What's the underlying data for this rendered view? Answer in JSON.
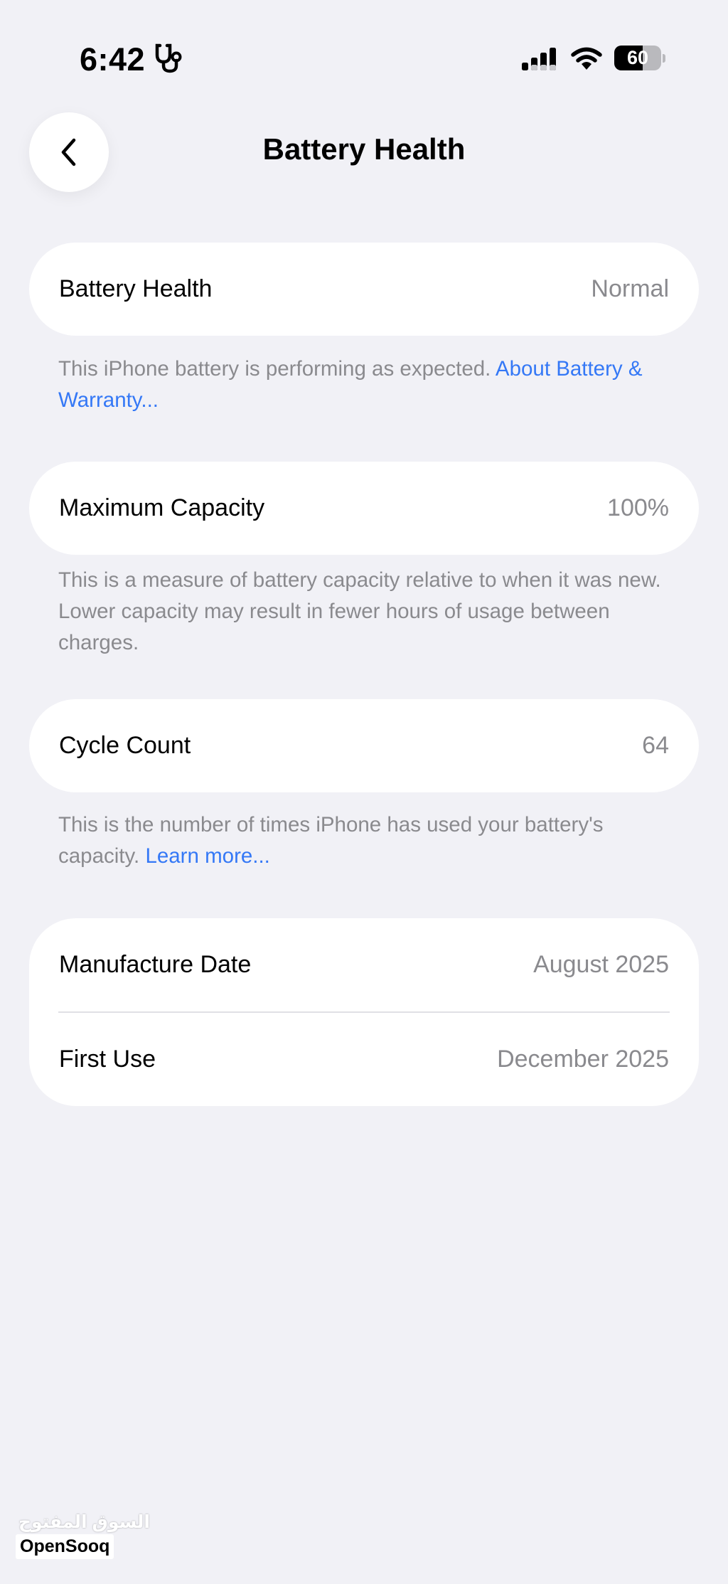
{
  "status_bar": {
    "time": "6:42",
    "battery_level": "60",
    "battery_fraction": 0.6,
    "icons": [
      "stethoscope-icon",
      "cellular-signal-icon",
      "wifi-icon",
      "battery-icon"
    ]
  },
  "nav": {
    "back_icon": "chevron-left-icon",
    "title": "Battery Health"
  },
  "sections": {
    "health": {
      "label": "Battery Health",
      "value": "Normal",
      "footnote": "This iPhone battery is performing as expected.",
      "link": "About Battery & Warranty..."
    },
    "capacity": {
      "label": "Maximum Capacity",
      "value": "100%",
      "footnote": "This is a measure of battery capacity relative to when it was new. Lower capacity may result in fewer hours of usage between charges."
    },
    "cycles": {
      "label": "Cycle Count",
      "value": "64",
      "footnote": "This is the number of times iPhone has used your battery's capacity.",
      "link": "Learn more..."
    },
    "dates": {
      "manufacture_label": "Manufacture Date",
      "manufacture_value": "August 2025",
      "first_use_label": "First Use",
      "first_use_value": "December 2025"
    }
  },
  "watermark": {
    "arabic": "السوق المفتوح",
    "latin": "OpenSooq"
  },
  "colors": {
    "background": "#f1f1f6",
    "card": "#ffffff",
    "secondary_text": "#8a8a8e",
    "link": "#3478f6"
  }
}
